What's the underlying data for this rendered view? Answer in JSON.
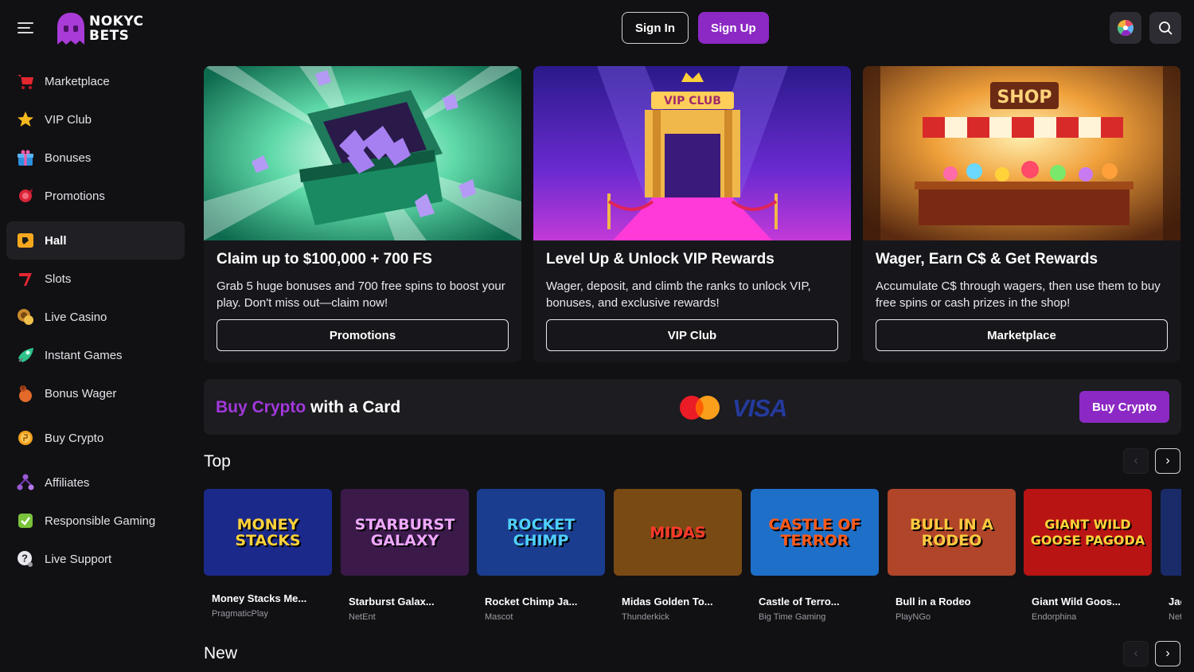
{
  "brand": {
    "line1": "NOKYC",
    "line2": "BETS"
  },
  "header": {
    "sign_in": "Sign In",
    "sign_up": "Sign Up"
  },
  "sidebar": {
    "items": [
      {
        "label": "Marketplace",
        "icon": "cart-icon"
      },
      {
        "label": "VIP Club",
        "icon": "star-icon"
      },
      {
        "label": "Bonuses",
        "icon": "gift-icon"
      },
      {
        "label": "Promotions",
        "icon": "promotion-icon"
      },
      {
        "label": "Hall",
        "icon": "hall-icon",
        "active": true
      },
      {
        "label": "Slots",
        "icon": "slots-icon"
      },
      {
        "label": "Live Casino",
        "icon": "chip-icon"
      },
      {
        "label": "Instant Games",
        "icon": "rocket-icon"
      },
      {
        "label": "Bonus Wager",
        "icon": "coins-icon"
      },
      {
        "label": "Buy Crypto",
        "icon": "crypto-coin-icon"
      },
      {
        "label": "Affiliates",
        "icon": "affiliates-icon"
      },
      {
        "label": "Responsible Gaming",
        "icon": "shield-check-icon"
      },
      {
        "label": "Live Support",
        "icon": "support-icon"
      }
    ]
  },
  "promos": [
    {
      "title": "Claim up to $100,000 + 700 FS",
      "desc": "Grab 5 huge bonuses and 700 free spins to boost your play. Don't miss out—claim now!",
      "button": "Promotions",
      "image_label": ""
    },
    {
      "title": "Level Up & Unlock VIP Rewards",
      "desc": "Wager, deposit, and climb the ranks to unlock VIP, bonuses, and exclusive rewards!",
      "button": "VIP Club",
      "image_label": "VIP CLUB"
    },
    {
      "title": "Wager, Earn C$ & Get Rewards",
      "desc": "Accumulate C$ through wagers, then use them to buy free spins or cash prizes in the shop!",
      "button": "Marketplace",
      "image_label": "SHOP"
    }
  ],
  "crypto_banner": {
    "highlight": "Buy Crypto",
    "rest": " with a Card",
    "visa": "VISA",
    "button": "Buy Crypto"
  },
  "sections": {
    "top": "Top",
    "new": "New"
  },
  "games": [
    {
      "name": "Money Stacks Me...",
      "provider": "PragmaticPlay",
      "thumb": "MONEY STACKS",
      "bg": "#1b2a8a",
      "fg": "#ffd23a"
    },
    {
      "name": "Starburst Galax...",
      "provider": "NetEnt",
      "thumb": "STARBURST GALAXY",
      "bg": "#3b1a4a",
      "fg": "#f0a8ff"
    },
    {
      "name": "Rocket Chimp Ja...",
      "provider": "Mascot",
      "thumb": "ROCKET CHIMP",
      "bg": "#1b3d8f",
      "fg": "#4fd0ff"
    },
    {
      "name": "Midas Golden To...",
      "provider": "Thunderkick",
      "thumb": "MIDAS",
      "bg": "#7a4a14",
      "fg": "#ff3a2a"
    },
    {
      "name": "Castle of Terro...",
      "provider": "Big Time Gaming",
      "thumb": "CASTLE OF TERROR",
      "bg": "#1d6fc8",
      "fg": "#ff5a1a"
    },
    {
      "name": "Bull in a Rodeo",
      "provider": "PlayNGo",
      "thumb": "BULL IN A RODEO",
      "bg": "#b0452a",
      "fg": "#ffc940"
    },
    {
      "name": "Giant Wild Goos...",
      "provider": "Endorphina",
      "thumb": "GIANT WILD GOOSE PAGODA",
      "bg": "#b81414",
      "fg": "#ffd23a"
    },
    {
      "name": "Jac",
      "provider": "Net",
      "thumb": "",
      "bg": "#1a2b6a",
      "fg": "#ffffff"
    }
  ],
  "colors": {
    "accent": "#8c29c4",
    "background": "#111114",
    "panel": "#17171b"
  }
}
